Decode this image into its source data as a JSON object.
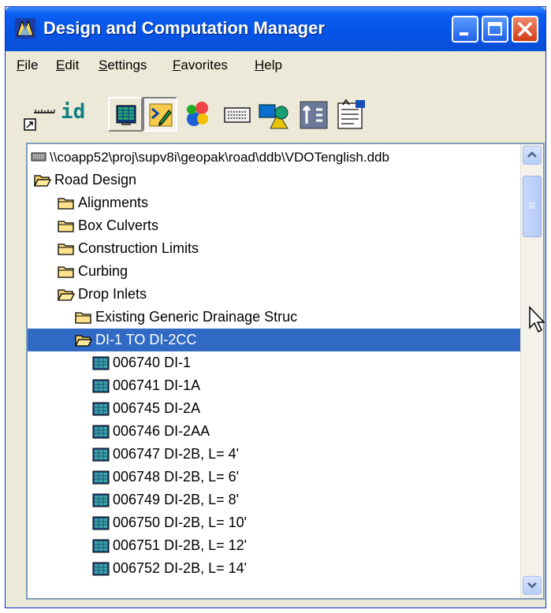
{
  "window": {
    "title": "Design and Computation Manager",
    "controls": {
      "minimize": "minimize-icon",
      "maximize": "maximize-icon",
      "close": "close-icon"
    }
  },
  "menu": [
    {
      "label": "File"
    },
    {
      "label": "Edit"
    },
    {
      "label": "Settings"
    },
    {
      "label": "Favorites"
    },
    {
      "label": "Help"
    }
  ],
  "toolbar": {
    "id_label": "id",
    "tools": [
      {
        "name": "place-dialog-icon"
      },
      {
        "name": "design-mode-icon",
        "pressed": true
      },
      {
        "name": "palette-icon"
      },
      {
        "name": "keyboard-icon"
      },
      {
        "name": "shapes-icon"
      },
      {
        "name": "compute-icon"
      },
      {
        "name": "properties-icon"
      }
    ]
  },
  "tree": {
    "root": "\\\\coapp52\\proj\\supv8i\\geopak\\road\\ddb\\VDOTenglish.ddb",
    "items": [
      {
        "label": "Road Design",
        "type": "folder-open",
        "depth": 0
      },
      {
        "label": "Alignments",
        "type": "folder",
        "depth": 1
      },
      {
        "label": "Box Culverts",
        "type": "folder",
        "depth": 1
      },
      {
        "label": "Construction Limits",
        "type": "folder",
        "depth": 1
      },
      {
        "label": "Curbing",
        "type": "folder",
        "depth": 1
      },
      {
        "label": "Drop Inlets",
        "type": "folder-open",
        "depth": 1
      },
      {
        "label": "Existing Generic Drainage Struc",
        "type": "folder",
        "depth": 2
      },
      {
        "label": "DI-1 TO DI-2CC",
        "type": "folder-open",
        "depth": 2,
        "selected": true
      },
      {
        "label": "006740 DI-1",
        "type": "item",
        "depth": 3
      },
      {
        "label": "006741 DI-1A",
        "type": "item",
        "depth": 3
      },
      {
        "label": "006745 DI-2A",
        "type": "item",
        "depth": 3
      },
      {
        "label": "006746 DI-2AA",
        "type": "item",
        "depth": 3
      },
      {
        "label": "006747 DI-2B, L= 4'",
        "type": "item",
        "depth": 3
      },
      {
        "label": "006748 DI-2B, L= 6'",
        "type": "item",
        "depth": 3
      },
      {
        "label": "006749 DI-2B, L= 8'",
        "type": "item",
        "depth": 3
      },
      {
        "label": "006750 DI-2B, L= 10'",
        "type": "item",
        "depth": 3
      },
      {
        "label": "006751 DI-2B, L= 12'",
        "type": "item",
        "depth": 3
      },
      {
        "label": "006752 DI-2B, L= 14'",
        "type": "item",
        "depth": 3
      }
    ]
  }
}
